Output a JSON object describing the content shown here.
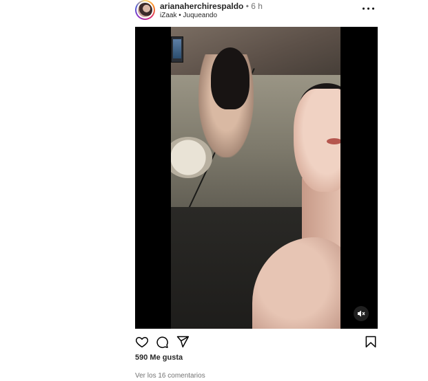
{
  "post": {
    "username": "arianaherchirespaldo",
    "separator": "•",
    "time": "6 h",
    "audio": "iZaak • Juqueando",
    "likes_count": "590",
    "likes_label": "Me gusta",
    "comments_link": "Ver los 16 comentarios"
  },
  "icons": {
    "more": "more-horizontal-icon",
    "like": "heart-icon",
    "comment": "comment-icon",
    "share": "send-icon",
    "save": "bookmark-icon",
    "mute": "speaker-muted-icon"
  },
  "colors": {
    "text_primary": "#262626",
    "text_secondary": "#737373",
    "media_bg": "#000000"
  }
}
